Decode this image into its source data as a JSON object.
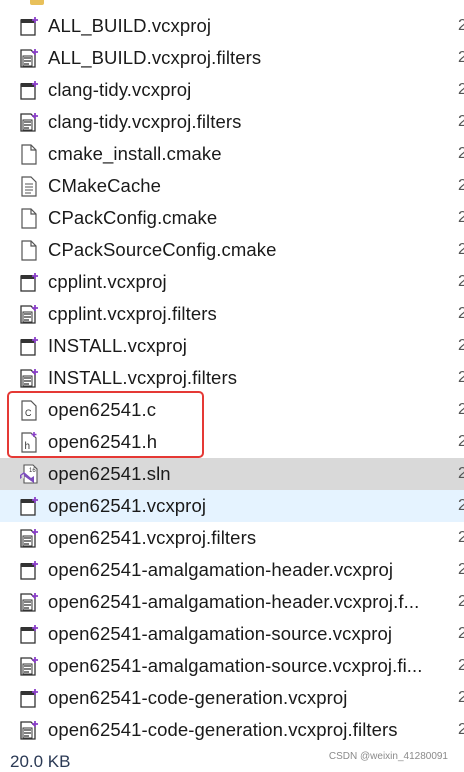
{
  "files": [
    {
      "name": "ALL_BUILD.vcxproj",
      "icon": "vcxproj-icon"
    },
    {
      "name": "ALL_BUILD.vcxproj.filters",
      "icon": "filters-icon"
    },
    {
      "name": "clang-tidy.vcxproj",
      "icon": "vcxproj-icon"
    },
    {
      "name": "clang-tidy.vcxproj.filters",
      "icon": "filters-icon"
    },
    {
      "name": "cmake_install.cmake",
      "icon": "blank-file-icon"
    },
    {
      "name": "CMakeCache",
      "icon": "text-file-icon"
    },
    {
      "name": "CPackConfig.cmake",
      "icon": "blank-file-icon"
    },
    {
      "name": "CPackSourceConfig.cmake",
      "icon": "blank-file-icon"
    },
    {
      "name": "cpplint.vcxproj",
      "icon": "vcxproj-icon"
    },
    {
      "name": "cpplint.vcxproj.filters",
      "icon": "filters-icon"
    },
    {
      "name": "INSTALL.vcxproj",
      "icon": "vcxproj-icon"
    },
    {
      "name": "INSTALL.vcxproj.filters",
      "icon": "filters-icon"
    },
    {
      "name": "open62541.c",
      "icon": "c-source-icon"
    },
    {
      "name": "open62541.h",
      "icon": "h-header-icon"
    },
    {
      "name": "open62541.sln",
      "icon": "vs-solution-icon",
      "state": "selected"
    },
    {
      "name": "open62541.vcxproj",
      "icon": "vcxproj-icon",
      "state": "hovered"
    },
    {
      "name": "open62541.vcxproj.filters",
      "icon": "filters-icon"
    },
    {
      "name": "open62541-amalgamation-header.vcxproj",
      "icon": "vcxproj-icon"
    },
    {
      "name": "open62541-amalgamation-header.vcxproj.f...",
      "icon": "filters-icon"
    },
    {
      "name": "open62541-amalgamation-source.vcxproj",
      "icon": "vcxproj-icon"
    },
    {
      "name": "open62541-amalgamation-source.vcxproj.fi...",
      "icon": "filters-icon"
    },
    {
      "name": "open62541-code-generation.vcxproj",
      "icon": "vcxproj-icon"
    },
    {
      "name": "open62541-code-generation.vcxproj.filters",
      "icon": "filters-icon"
    }
  ],
  "status": {
    "size": "20.0 KB"
  },
  "watermark": "CSDN @weixin_41280091",
  "colors": {
    "highlight_border": "#e53935",
    "selected_row": "#d9d9d9",
    "hover_row": "#e5f3ff",
    "vs_purple": "#7c4dbd"
  }
}
